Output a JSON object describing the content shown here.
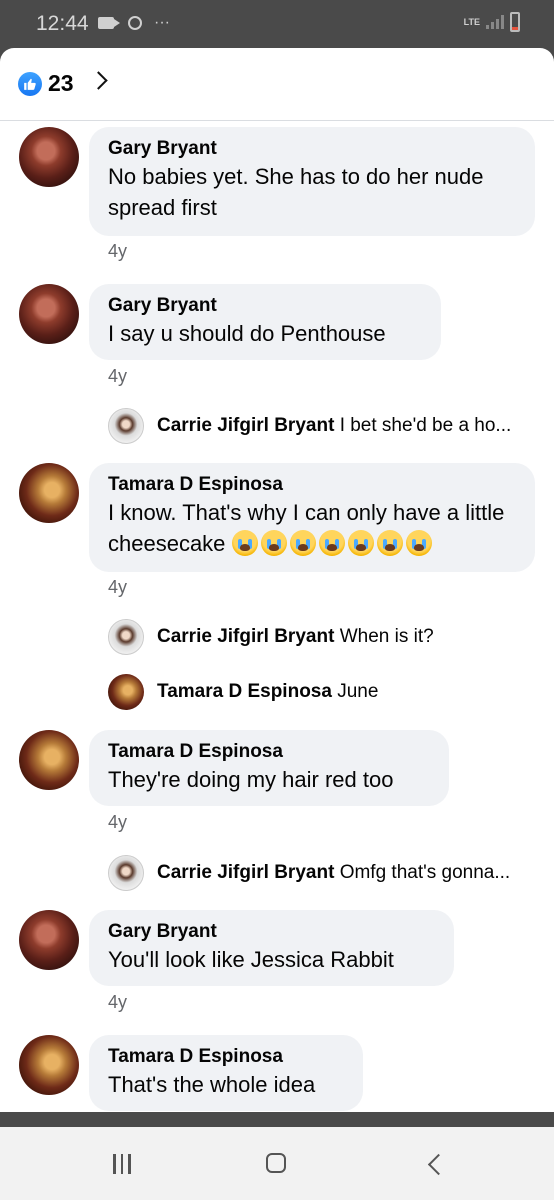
{
  "status_bar": {
    "time": "12:44",
    "overflow": "···",
    "network": "LTE",
    "icons": [
      "video-camera-icon",
      "sync-icon",
      "signal-icon",
      "battery-icon"
    ]
  },
  "reactions": {
    "count": "23",
    "icon": "like-icon"
  },
  "comments": [
    {
      "author": "Gary Bryant",
      "text": "No babies yet. She has to do her nude spread first",
      "time": "4y",
      "avatar": "gary"
    },
    {
      "author": "Gary Bryant",
      "text": "I say u should do Penthouse",
      "time": "4y",
      "avatar": "gary"
    },
    {
      "author": "Carrie Jifgirl Bryant",
      "text": "I bet she'd be a ho...",
      "avatar": "carrie",
      "reply": true
    },
    {
      "author": "Tamara D Espinosa",
      "text": "I know. That's why I can only have a little cheesecake",
      "emoji": "loudly-crying-face-icon x7",
      "time": "4y",
      "avatar": "tamara"
    },
    {
      "author": "Carrie Jifgirl Bryant",
      "text": "When is it?",
      "avatar": "carrie",
      "reply": true
    },
    {
      "author": "Tamara D Espinosa",
      "text": "June",
      "avatar": "tamara",
      "reply": true
    },
    {
      "author": "Tamara D Espinosa",
      "text": "They're doing my hair red too",
      "time": "4y",
      "avatar": "tamara"
    },
    {
      "author": "Carrie Jifgirl Bryant",
      "text": "Omfg that's gonna...",
      "avatar": "carrie",
      "reply": true
    },
    {
      "author": "Gary Bryant",
      "text": "You'll look like Jessica Rabbit",
      "time": "4y",
      "avatar": "gary"
    },
    {
      "author": "Tamara D Espinosa",
      "text": "That's the whole idea",
      "avatar": "tamara"
    }
  ],
  "nav": [
    "recent-apps-icon",
    "home-icon",
    "back-icon"
  ]
}
